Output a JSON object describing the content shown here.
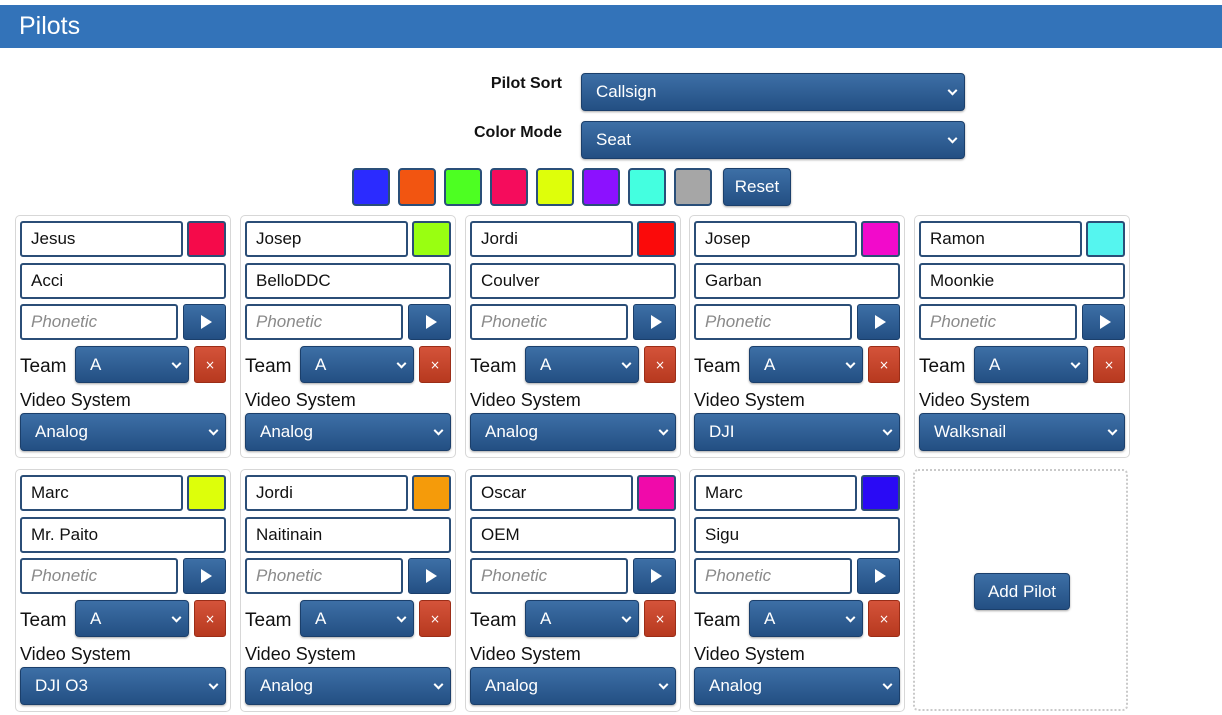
{
  "header": {
    "title": "Pilots"
  },
  "controls": {
    "pilot_sort_label": "Pilot Sort",
    "pilot_sort_value": "Callsign",
    "color_mode_label": "Color Mode",
    "color_mode_value": "Seat"
  },
  "seat_colors": [
    "#2b2bff",
    "#f25511",
    "#4dff22",
    "#f50c5c",
    "#deff0a",
    "#8c11ff",
    "#44ffe0",
    "#a6a6a6"
  ],
  "reset_label": "Reset",
  "add_pilot_label": "Add Pilot",
  "card_labels": {
    "phonetic_placeholder": "Phonetic",
    "team": "Team",
    "video_system": "Video System",
    "delete_symbol": "×"
  },
  "pilots": [
    {
      "name": "Jesus",
      "callsign": "Acci",
      "color": "#f50a4a",
      "team": "A",
      "video": "Analog"
    },
    {
      "name": "Josep",
      "callsign": "BelloDDC",
      "color": "#99ff11",
      "team": "A",
      "video": "Analog"
    },
    {
      "name": "Jordi",
      "callsign": "Coulver",
      "color": "#fb0a0a",
      "team": "A",
      "video": "Analog"
    },
    {
      "name": "Josep",
      "callsign": "Garban",
      "color": "#f20acb",
      "team": "A",
      "video": "DJI"
    },
    {
      "name": "Ramon",
      "callsign": "Moonkie",
      "color": "#55f5ef",
      "team": "A",
      "video": "Walksnail"
    },
    {
      "name": "Marc",
      "callsign": "Mr. Paito",
      "color": "#ddff0a",
      "team": "A",
      "video": "DJI O3"
    },
    {
      "name": "Jordi",
      "callsign": "Naitinain",
      "color": "#f59b0a",
      "team": "A",
      "video": "Analog"
    },
    {
      "name": "Oscar",
      "callsign": "OEM",
      "color": "#f00aaa",
      "team": "A",
      "video": "Analog"
    },
    {
      "name": "Marc",
      "callsign": "Sigu",
      "color": "#2a0af5",
      "team": "A",
      "video": "Analog"
    }
  ]
}
